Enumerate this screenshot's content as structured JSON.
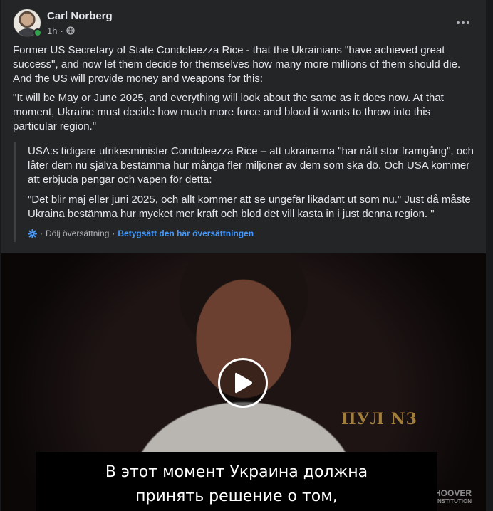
{
  "post": {
    "author": "Carl Norberg",
    "time": "1h",
    "separator": "·",
    "privacy_icon": "globe-icon",
    "body": [
      "Former US Secretary of State Condoleezza Rice - that the Ukrainians \"have achieved great success\", and now let them decide for themselves how many more millions of them should die. And the US will provide money and weapons for this:",
      "\"It will be May or June 2025, and everything will look about the same as it does now. At that moment, Ukraine must decide how much more force and blood it wants to throw into this particular region.\""
    ]
  },
  "translation": {
    "body": [
      "USA:s tidigare utrikesminister Condoleezza Rice – att ukrainarna \"har nått stor framgång\", och låter dem nu själva bestämma hur många fler miljoner av dem som ska dö. Och USA kommer att erbjuda pengar och vapen för detta:",
      "\"Det blir maj eller juni 2025, och allt kommer att se ungefär likadant ut som nu.\" Just då måste Ukraina bestämma hur mycket mer kraft och blod det vill kasta in i just denna region. \""
    ],
    "hide_label": "Dölj översättning",
    "rate_label": "Betygsätt den här översättningen",
    "dot": "·"
  },
  "video": {
    "subtitle_lines": [
      "В этот момент Украина должна",
      "принять решение о том,"
    ],
    "watermark": "ПУЛ N3",
    "logo_lines": [
      "HOOVER",
      "INSTITUTION"
    ]
  },
  "colors": {
    "background": "#18191a",
    "card": "#242526",
    "text": "#e4e6eb",
    "secondary": "#b0b3b8",
    "link_blue": "#4599ff",
    "online": "#31a24c"
  }
}
